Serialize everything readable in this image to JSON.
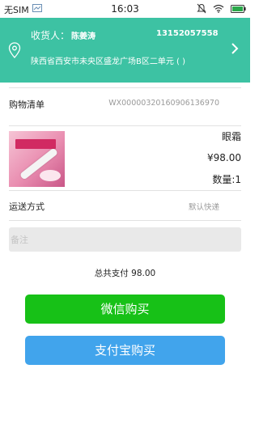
{
  "status_bar": {
    "carrier": "无SIM",
    "time": "16:03"
  },
  "address": {
    "recipient_label": "收货人：",
    "recipient_name": "陈姜涛",
    "phone": "13152057558",
    "full_address": "陕西省西安市未央区盛龙广场B区二单元 ( )"
  },
  "order": {
    "shopping_list_label": "购物清单",
    "order_number": "WX0000032016090613​6970"
  },
  "product": {
    "name": "眼霜",
    "price": "¥98.00",
    "quantity": "数量:1"
  },
  "shipping": {
    "label": "运送方式",
    "value": "默认快递"
  },
  "note": {
    "placeholder": "备注"
  },
  "total": "总共支付 98.00",
  "buttons": {
    "wechat": "微信购买",
    "alipay": "支付宝购买"
  },
  "colors": {
    "banner": "#3dc2a3",
    "wechat": "#17c117",
    "alipay": "#41a4ec"
  }
}
